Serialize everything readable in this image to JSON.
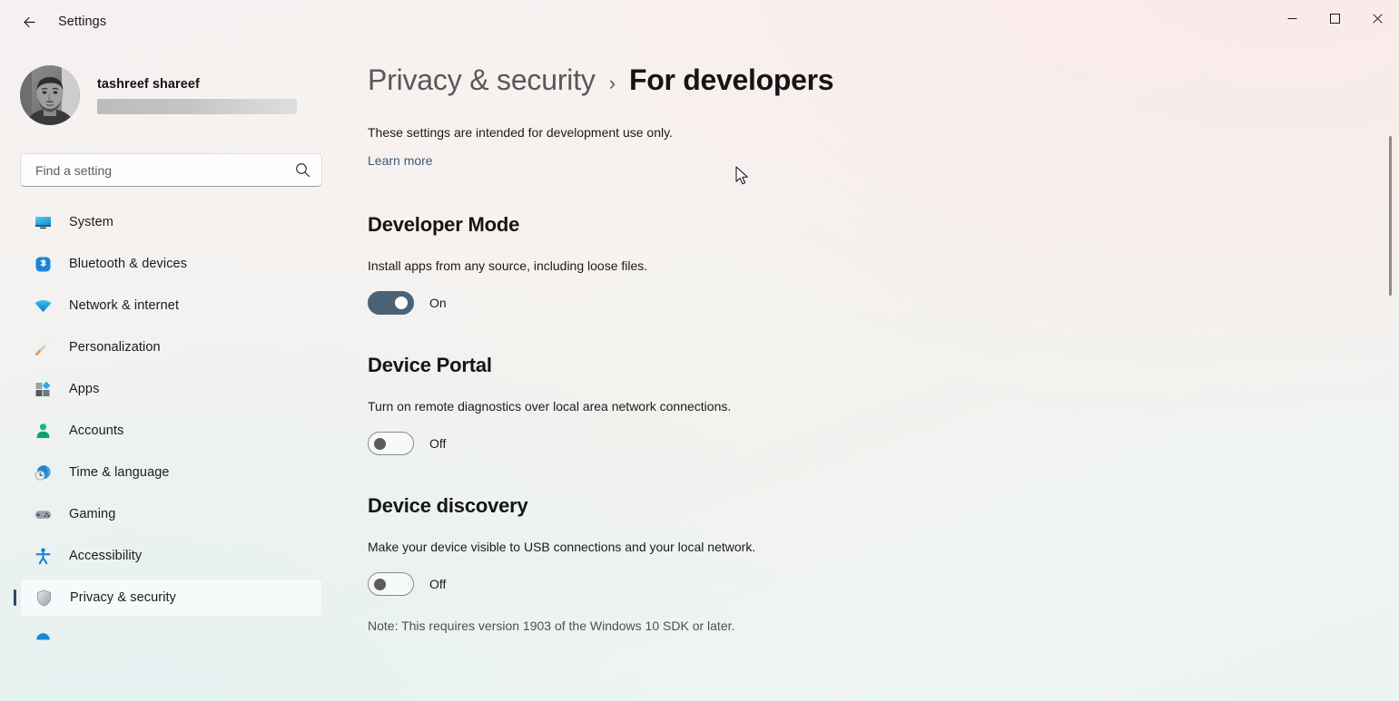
{
  "window": {
    "app_title": "Settings",
    "back_icon": "arrow-left-icon",
    "controls": {
      "minimize": "minimize-icon",
      "maximize": "maximize-icon",
      "close": "close-icon"
    }
  },
  "sidebar": {
    "profile": {
      "name": "tashreef shareef",
      "email_redacted": true
    },
    "search": {
      "placeholder": "Find a setting",
      "icon": "search-icon"
    },
    "items": [
      {
        "label": "System",
        "icon": "system-monitor-icon",
        "selected": false
      },
      {
        "label": "Bluetooth & devices",
        "icon": "bluetooth-icon",
        "selected": false
      },
      {
        "label": "Network & internet",
        "icon": "wifi-icon",
        "selected": false
      },
      {
        "label": "Personalization",
        "icon": "paintbrush-icon",
        "selected": false
      },
      {
        "label": "Apps",
        "icon": "apps-icon",
        "selected": false
      },
      {
        "label": "Accounts",
        "icon": "person-icon",
        "selected": false
      },
      {
        "label": "Time & language",
        "icon": "clock-globe-icon",
        "selected": false
      },
      {
        "label": "Gaming",
        "icon": "gamepad-icon",
        "selected": false
      },
      {
        "label": "Accessibility",
        "icon": "accessibility-person-icon",
        "selected": false
      },
      {
        "label": "Privacy & security",
        "icon": "shield-icon",
        "selected": true
      },
      {
        "label": "",
        "icon": "windows-update-icon",
        "selected": false
      }
    ]
  },
  "main": {
    "breadcrumb": {
      "parent": "Privacy & security",
      "separator": "›",
      "current": "For developers"
    },
    "intro": "These settings are intended for development use only.",
    "learn_more": "Learn more",
    "sections": [
      {
        "title": "Developer Mode",
        "description": "Install apps from any source, including loose files.",
        "toggle_state": "On",
        "toggle_on": true
      },
      {
        "title": "Device Portal",
        "description": "Turn on remote diagnostics over local area network connections.",
        "toggle_state": "Off",
        "toggle_on": false
      },
      {
        "title": "Device discovery",
        "description": "Make your device visible to USB connections and your local network.",
        "toggle_state": "Off",
        "toggle_on": false
      }
    ],
    "note": "Note: This requires version 1903 of the Windows 10 SDK or later."
  },
  "colors": {
    "accent_selected_bar": "#2c4862",
    "toggle_on_fill": "#4a6376",
    "link": "#3a5a78",
    "title_text": "#151515"
  }
}
